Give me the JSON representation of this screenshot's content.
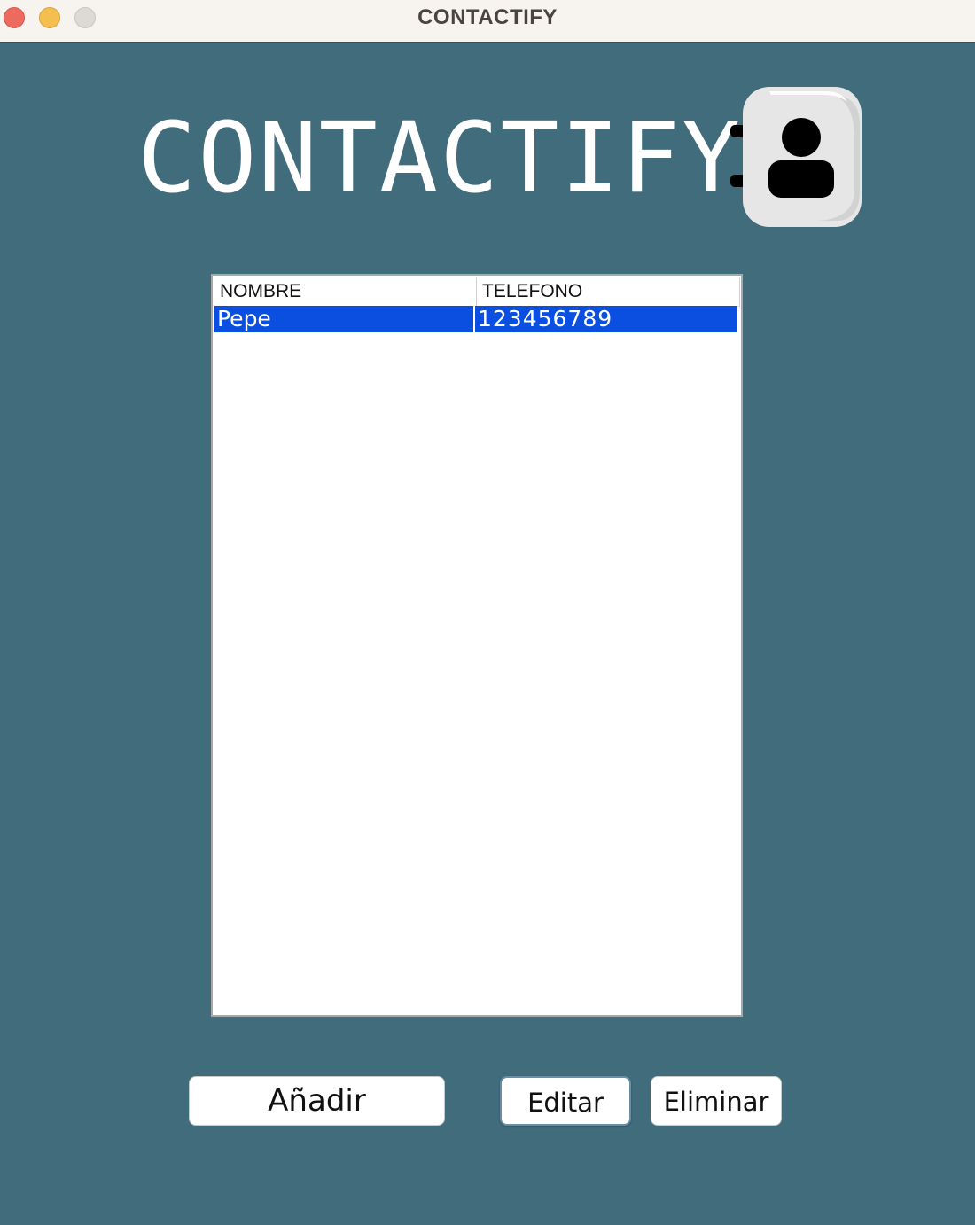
{
  "window": {
    "title": "CONTACTIFY"
  },
  "header": {
    "title": "CONTACTIFY",
    "icon": "contact-book-icon"
  },
  "table": {
    "columns": [
      "NOMBRE",
      "TELEFONO"
    ],
    "rows": [
      {
        "nombre": "Pepe",
        "telefono": "123456789",
        "selected": true
      }
    ]
  },
  "actions": {
    "add_label": "Añadir",
    "edit_label": "Editar",
    "delete_label": "Eliminar"
  },
  "colors": {
    "background": "#406c7c",
    "selection": "#0a4fe0",
    "titlebar": "#f7f3ef"
  }
}
